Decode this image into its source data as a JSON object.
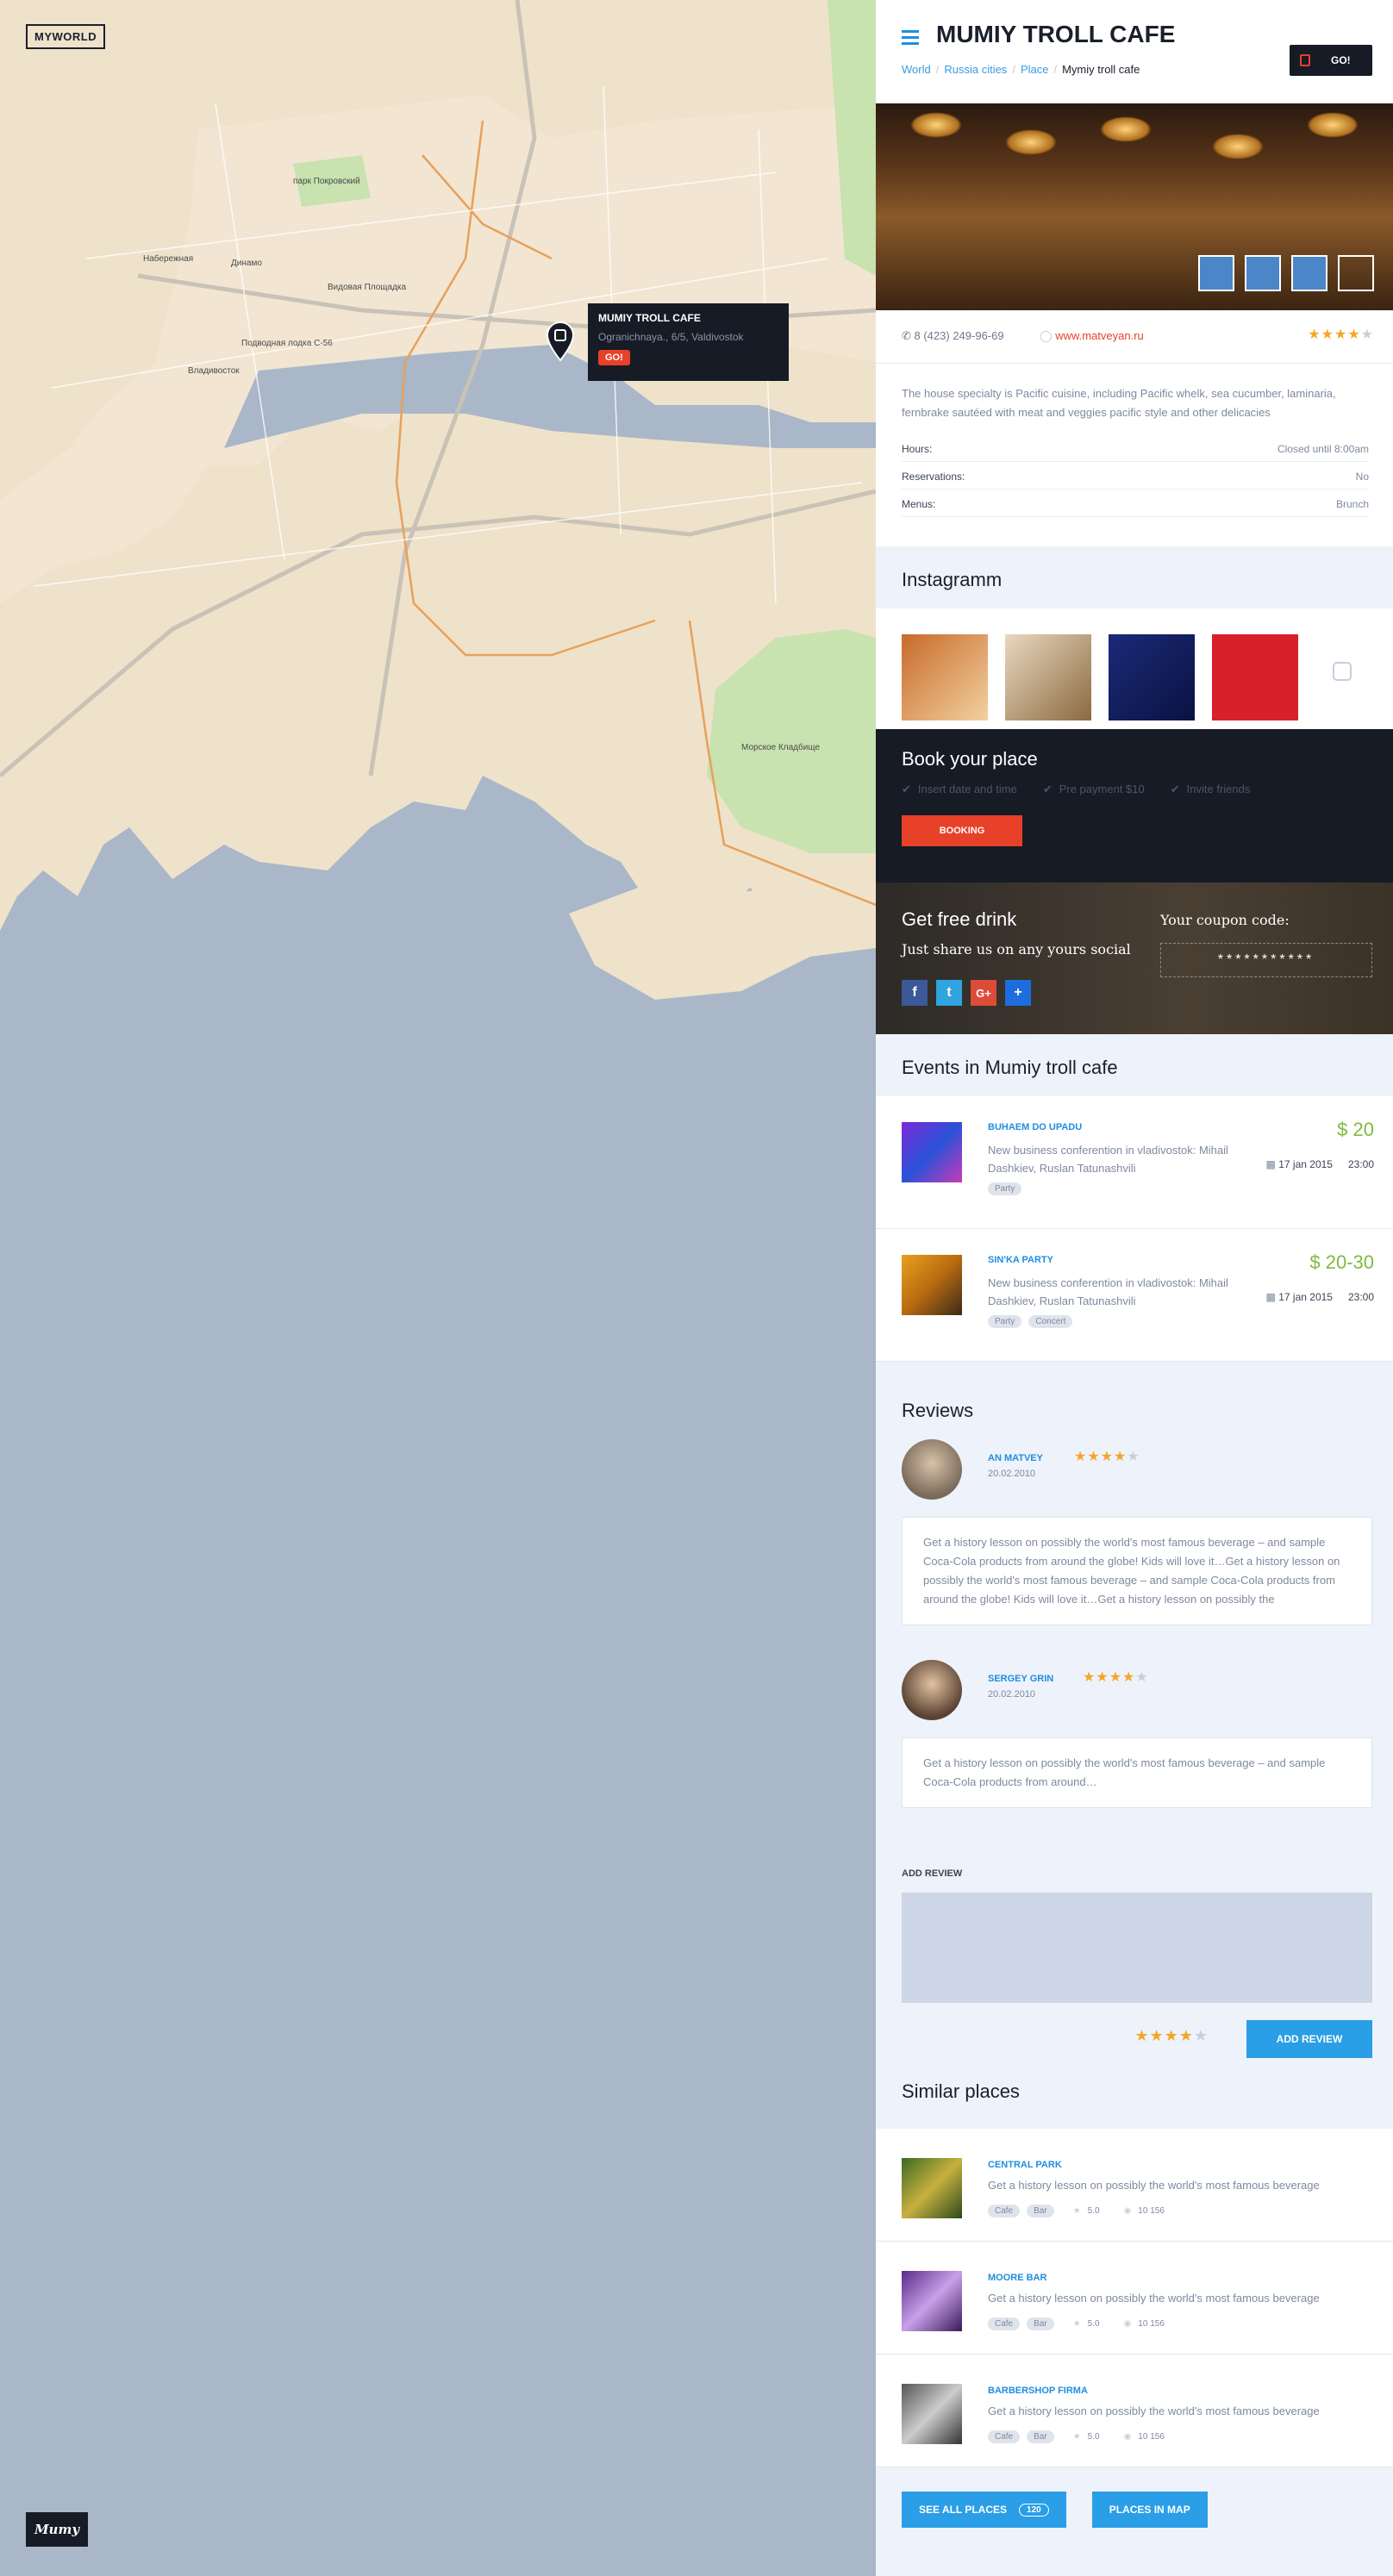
{
  "app": {
    "logo": "MYWORLD",
    "bottom_logo": "Mumy"
  },
  "map": {
    "labels": [
      "Набережная",
      "Динамо",
      "Видовая Площадка",
      "Подводная лодка С-56",
      "Владивосток",
      "Морское Кладбище",
      "парк Покровский"
    ],
    "popup": {
      "title": "MUMIY TROLL CAFE",
      "address": "Ogranichnaya., 6/5, Valdivostok",
      "go": "GO!"
    }
  },
  "header": {
    "title": "MUMIY TROLL CAFE",
    "breadcrumbs": [
      "World",
      "Russia cities",
      "Place",
      "Mymiy troll cafe"
    ],
    "go_label": "GO!"
  },
  "place": {
    "phone": "8 (423) 249-96-69",
    "website": "www.matveyan.ru",
    "rating": 4,
    "description": "The house specialty is Pacific cuisine, including Pacific whelk, sea cucumber, laminaria, fernbrake sautéed with meat and veggies pacific style and other delicacies",
    "info": [
      {
        "label": "Hours:",
        "value": "Closed until 8:00am"
      },
      {
        "label": "Reservations:",
        "value": "No"
      },
      {
        "label": "Menus:",
        "value": "Brunch"
      }
    ]
  },
  "instagram": {
    "title": "Instagramm"
  },
  "booking": {
    "title": "Book your place",
    "options": [
      "Insert date and time",
      "Pre payment $10",
      "Invite friends"
    ],
    "button": "BOOKING"
  },
  "drink": {
    "title": "Get free drink",
    "subtitle": "Just share us on any yours social",
    "coupon_label": "Your coupon code:",
    "coupon_code": "***********"
  },
  "events": {
    "title": "Events in Mumiy troll cafe",
    "items": [
      {
        "name": "BUHAEM DO UPADU",
        "desc": "New business conferention in vladivostok: Mihail Dashkiev, Ruslan Tatunashvili",
        "price": "$ 20",
        "date": "17 jan 2015",
        "time": "23:00",
        "tags": [
          "Party"
        ]
      },
      {
        "name": "SIN'KA PARTY",
        "desc": "New business conferention in vladivostok: Mihail Dashkiev, Ruslan Tatunashvili",
        "price": "$ 20-30",
        "date": "17 jan 2015",
        "time": "23:00",
        "tags": [
          "Party",
          "Concert"
        ]
      }
    ]
  },
  "reviews": {
    "title": "Reviews",
    "items": [
      {
        "name": "AN MATVEY",
        "date": "20.02.2010",
        "rating": 4,
        "text": "Get a history lesson on possibly the world's most famous beverage – and sample Coca-Cola products from around the globe! Kids will love it…Get a history lesson on possibly the world's most famous beverage – and sample Coca-Cola products from around the globe! Kids will love it…Get a history lesson on possibly the"
      },
      {
        "name": "SERGEY GRIN",
        "date": "20.02.2010",
        "rating": 4,
        "text": "Get a history lesson on possibly the world's most famous beverage – and sample Coca-Cola products from around…"
      }
    ],
    "add_label": "ADD REVIEW",
    "add_button": "ADD REVIEW",
    "new_rating": 4
  },
  "similar": {
    "title": "Similar places",
    "items": [
      {
        "name": "CENTRAL PARK",
        "desc": "Get a history lesson on possibly the world's most famous beverage",
        "tags": [
          "Cafe",
          "Bar"
        ],
        "rating": "5.0",
        "views": "10 156"
      },
      {
        "name": "MOORE BAR",
        "desc": "Get a history lesson on possibly the world's most famous beverage",
        "tags": [
          "Cafe",
          "Bar"
        ],
        "rating": "5.0",
        "views": "10 156"
      },
      {
        "name": "BARBERSHOP FIRMA",
        "desc": "Get a history lesson on possibly the world's most famous beverage",
        "tags": [
          "Cafe",
          "Bar"
        ],
        "rating": "5.0",
        "views": "10 156"
      }
    ],
    "see_all": "SEE ALL PLACES",
    "see_all_count": "120",
    "in_map": "PLACES IN MAP"
  },
  "colors": {
    "accent": "#1e8ee0",
    "go": "#e8412a",
    "dark": "#161b26",
    "price": "#7dbb3f"
  }
}
